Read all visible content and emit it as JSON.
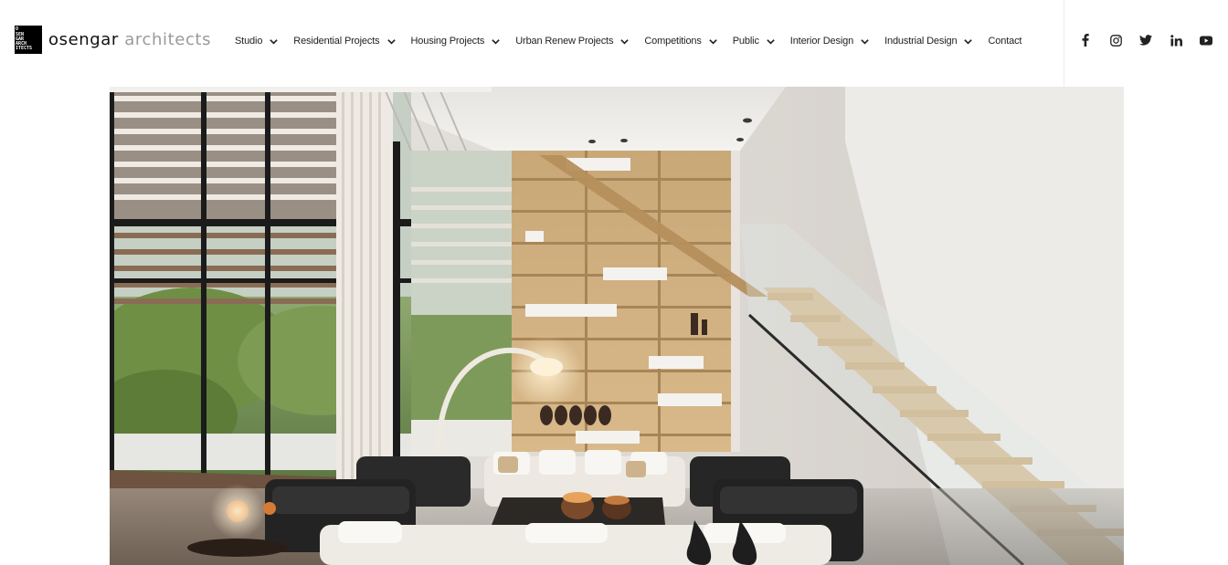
{
  "brand": {
    "logo_mark_lines": [
      "O",
      "SEN",
      "GAR",
      "ARCH",
      "ITECTS"
    ],
    "name_primary": "osengar",
    "name_secondary": "architects"
  },
  "nav": {
    "items": [
      {
        "label": "Studio",
        "has_dropdown": true
      },
      {
        "label": "Residential Projects",
        "has_dropdown": true
      },
      {
        "label": "Housing Projects",
        "has_dropdown": true
      },
      {
        "label": "Urban Renew Projects",
        "has_dropdown": true
      },
      {
        "label": "Competitions",
        "has_dropdown": true
      },
      {
        "label": "Public",
        "has_dropdown": true
      },
      {
        "label": "Interior Design",
        "has_dropdown": true
      },
      {
        "label": "Industrial Design",
        "has_dropdown": true
      },
      {
        "label": "Contact",
        "has_dropdown": false
      }
    ]
  },
  "social": {
    "icons": [
      "facebook-icon",
      "instagram-icon",
      "twitter-icon",
      "linkedin-icon",
      "youtube-icon"
    ]
  },
  "hero": {
    "image_subject": "interior-living-room-render"
  },
  "colors": {
    "text": "#222222",
    "brand_secondary": "#9a9a9a",
    "divider": "#ececec"
  }
}
